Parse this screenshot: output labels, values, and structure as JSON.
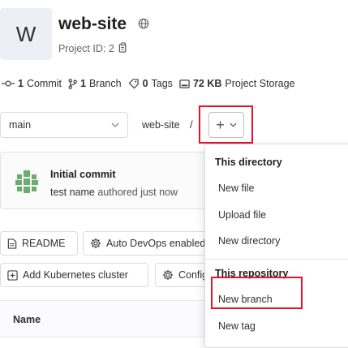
{
  "project": {
    "avatar_letter": "W",
    "name": "web-site",
    "id_label": "Project ID: 2",
    "visibility_icon": "globe-icon"
  },
  "stats": {
    "commits_count": "1",
    "commits_label": "Commit",
    "branches_count": "1",
    "branches_label": "Branch",
    "tags_count": "0",
    "tags_label": "Tags",
    "storage_size": "72 KB",
    "storage_label": "Project Storage"
  },
  "toolbar": {
    "branch": "main",
    "path": "web-site",
    "path_separator": "/",
    "add_symbol": "+"
  },
  "commit": {
    "title": "Initial commit",
    "author": "test name",
    "meta": "authored just now"
  },
  "actions": {
    "readme": "README",
    "auto_devops": "Auto DevOps enabled",
    "add_kubernetes": "Add Kubernetes cluster",
    "configure": "Configure Integrations"
  },
  "table": {
    "name_header": "Name"
  },
  "dropdown": {
    "this_directory": "This directory",
    "new_file": "New file",
    "upload_file": "Upload file",
    "new_directory": "New directory",
    "this_repository": "This repository",
    "new_branch": "New branch",
    "new_tag": "New tag"
  },
  "colors": {
    "highlight": "#e8102a",
    "avatar_bg": "#eeeef6",
    "commit_avatar": "#6aad6e"
  }
}
